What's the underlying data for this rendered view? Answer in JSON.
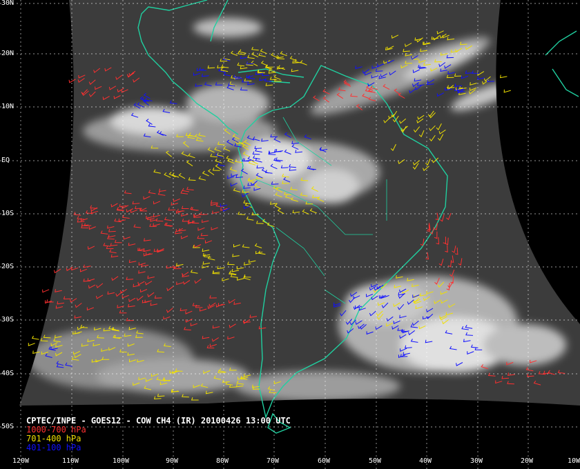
{
  "map": {
    "title": "CPTEC/INPE - GOES12 - COW CH4 (IR) 20100426 13:00 UTC",
    "legend": [
      {
        "label": "1000-700 hPa",
        "color": "#ff3030"
      },
      {
        "label": "701-400 hPa",
        "color": "#f0e000"
      },
      {
        "label": "401-100 hPa",
        "color": "#1010ff"
      }
    ],
    "lat_labels": [
      "30N",
      "20N",
      "10N",
      "EQ",
      "10S",
      "20S",
      "30S",
      "40S",
      "50S"
    ],
    "lon_labels": [
      "120W",
      "110W",
      "100W",
      "90W",
      "80W",
      "70W",
      "60W",
      "50W",
      "40W",
      "30W",
      "20W",
      "10W"
    ],
    "colors": {
      "background": "#000000",
      "coastline": "#20d0a0",
      "grid": "#ffffff",
      "imagery_dark": "#3c3c3c",
      "cloud": "#e6e6e6"
    }
  }
}
